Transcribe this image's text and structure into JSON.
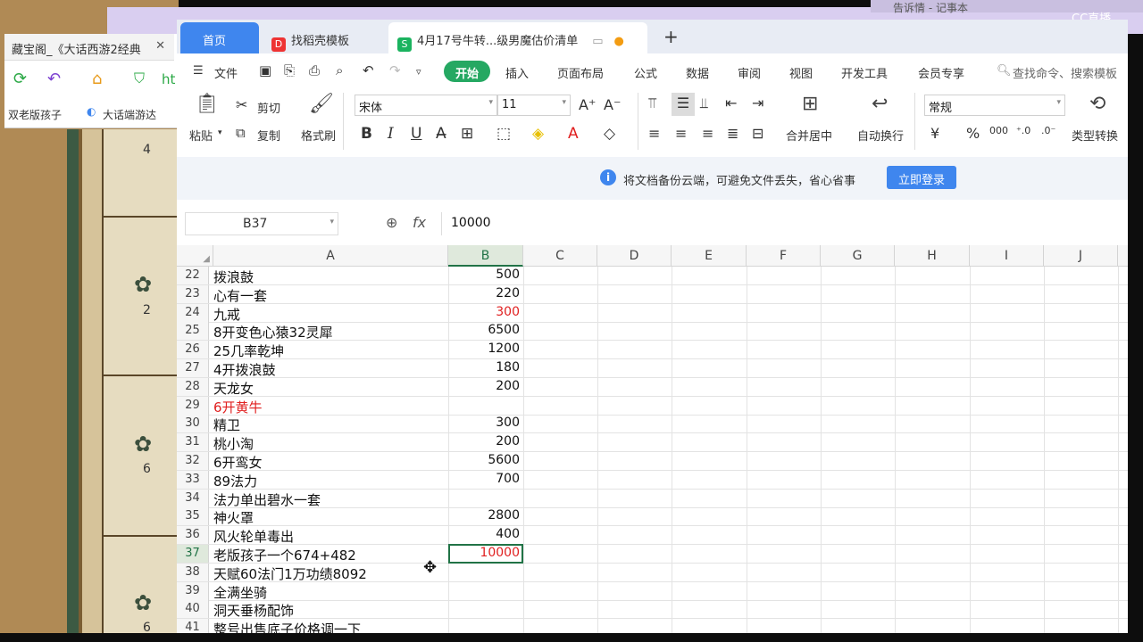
{
  "browser": {
    "tab_title": "藏宝阁_《大话西游2经典",
    "favorites": [
      "双老版孩子",
      "大话端游达"
    ],
    "url_fragment": "ht"
  },
  "notepad_title": "告诉情 - 记事本",
  "watermark": "CC直播",
  "game_slots": [
    "4",
    "2",
    "6",
    "6"
  ],
  "tabs": {
    "home": "首页",
    "template": "找稻壳模板",
    "file": "4月17号牛转...级男魔估价清单",
    "add": "+"
  },
  "menu": {
    "file": "文件",
    "items": [
      "开始",
      "插入",
      "页面布局",
      "公式",
      "数据",
      "审阅",
      "视图",
      "开发工具",
      "会员专享"
    ],
    "search": "查找命令、搜索模板"
  },
  "ribbon": {
    "paste": "粘贴",
    "cut": "剪切",
    "copy": "复制",
    "format_painter": "格式刷",
    "font_name": "宋体",
    "font_size": "11",
    "merge": "合并居中",
    "wrap": "自动换行",
    "number_format": "常规",
    "type_convert": "类型转换"
  },
  "notice": {
    "text": "将文档备份云端，可避免文件丢失，省心省事",
    "button": "立即登录"
  },
  "formula_bar": {
    "name_box": "B37",
    "fx": "fx",
    "value": "10000"
  },
  "columns": [
    "A",
    "B",
    "C",
    "D",
    "E",
    "F",
    "G",
    "H",
    "I",
    "J"
  ],
  "rows": [
    {
      "n": "22",
      "a": "拨浪鼓",
      "b": "500"
    },
    {
      "n": "23",
      "a": "心有一套",
      "b": "220"
    },
    {
      "n": "24",
      "a": "九戒",
      "b": "300",
      "b_red": true
    },
    {
      "n": "25",
      "a": "8开变色心猿32灵犀",
      "b": "6500"
    },
    {
      "n": "26",
      "a": "25几率乾坤",
      "b": "1200"
    },
    {
      "n": "27",
      "a": "4开拨浪鼓",
      "b": "180"
    },
    {
      "n": "28",
      "a": "天龙女",
      "b": "200"
    },
    {
      "n": "29",
      "a": "6开黄牛",
      "b": "",
      "a_red": true
    },
    {
      "n": "30",
      "a": "精卫",
      "b": "300"
    },
    {
      "n": "31",
      "a": "桃小淘",
      "b": "200"
    },
    {
      "n": "32",
      "a": "6开鸾女",
      "b": "5600"
    },
    {
      "n": "33",
      "a": "89法力",
      "b": "700"
    },
    {
      "n": "34",
      "a": "法力单出碧水一套",
      "b": ""
    },
    {
      "n": "35",
      "a": "神火罩",
      "b": "2800"
    },
    {
      "n": "36",
      "a": "风火轮单毒出",
      "b": "400"
    },
    {
      "n": "37",
      "a": "老版孩子一个674+482",
      "b": "10000",
      "b_red": true,
      "selected": true
    },
    {
      "n": "38",
      "a": "天赋60法门1万功绩8092",
      "b": ""
    },
    {
      "n": "39",
      "a": "全满坐骑",
      "b": ""
    },
    {
      "n": "40",
      "a": "洞天垂杨配饰",
      "b": ""
    },
    {
      "n": "41",
      "a": "整号出售底子价格调一下",
      "b": ""
    }
  ]
}
